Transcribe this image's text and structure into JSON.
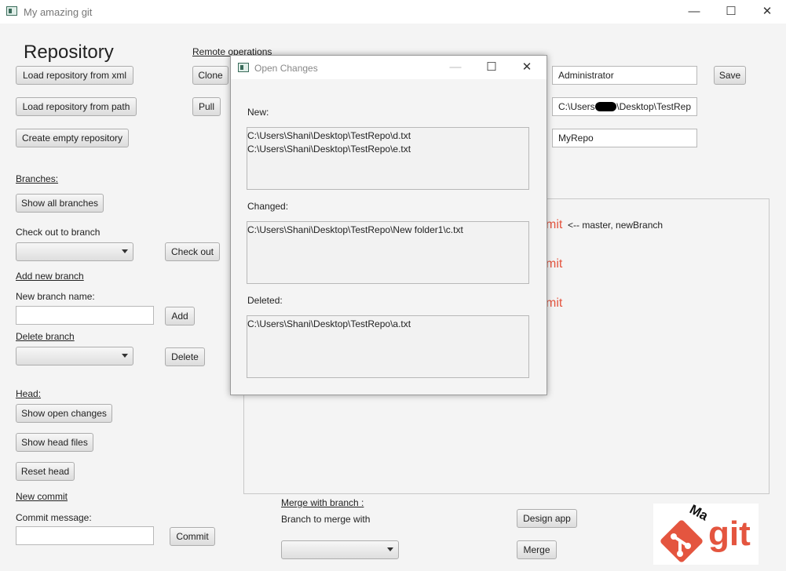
{
  "window": {
    "title": "My amazing git",
    "minimize": "—",
    "maximize": "☐",
    "close": "✕"
  },
  "left": {
    "heading": "Repository",
    "load_xml": "Load repository from xml",
    "load_path": "Load repository from path",
    "create_empty": "Create empty repository",
    "branches_label": "Branches:",
    "show_all_branches": "Show all branches",
    "checkout_label": "Check out to branch",
    "checkout_button": "Check out",
    "add_branch_label": "Add new branch",
    "new_branch_name_label": "New branch name:",
    "new_branch_value": "",
    "add_button": "Add",
    "delete_branch_label": "Delete branch",
    "delete_button": "Delete",
    "head_label": "Head:",
    "show_open_changes": "Show open changes",
    "show_head_files": "Show head files",
    "reset_head": "Reset head",
    "new_commit_label": "New commit",
    "commit_message_label": "Commit message:",
    "commit_message_value": "",
    "commit_button": "Commit"
  },
  "remote": {
    "label": "Remote operations",
    "clone": "Clone",
    "pull": "Pull"
  },
  "right": {
    "user_name": "Administrator",
    "save": "Save",
    "path_prefix": "C:\\Users",
    "path_suffix": "\\Desktop\\TestRep",
    "repo_name": "MyRepo"
  },
  "commits": {
    "items": [
      {
        "label": "mit",
        "pointer": "<-- master, newBranch"
      },
      {
        "label": "mit",
        "pointer": ""
      },
      {
        "label": "mit",
        "pointer": ""
      }
    ]
  },
  "merge": {
    "label": "Merge with branch :",
    "branch_label": "Branch to merge with",
    "design_app": "Design app",
    "merge_button": "Merge"
  },
  "logo": {
    "small_text": "Ma",
    "big_text": "git",
    "color": "#e4553f"
  },
  "dialog": {
    "title": "Open Changes",
    "new_label": "New:",
    "new_files": [
      "C:\\Users\\Shani\\Desktop\\TestRepo\\d.txt",
      "C:\\Users\\Shani\\Desktop\\TestRepo\\e.txt"
    ],
    "changed_label": "Changed:",
    "changed_files": [
      "C:\\Users\\Shani\\Desktop\\TestRepo\\New folder1\\c.txt"
    ],
    "deleted_label": "Deleted:",
    "deleted_files": [
      "C:\\Users\\Shani\\Desktop\\TestRepo\\a.txt"
    ]
  }
}
